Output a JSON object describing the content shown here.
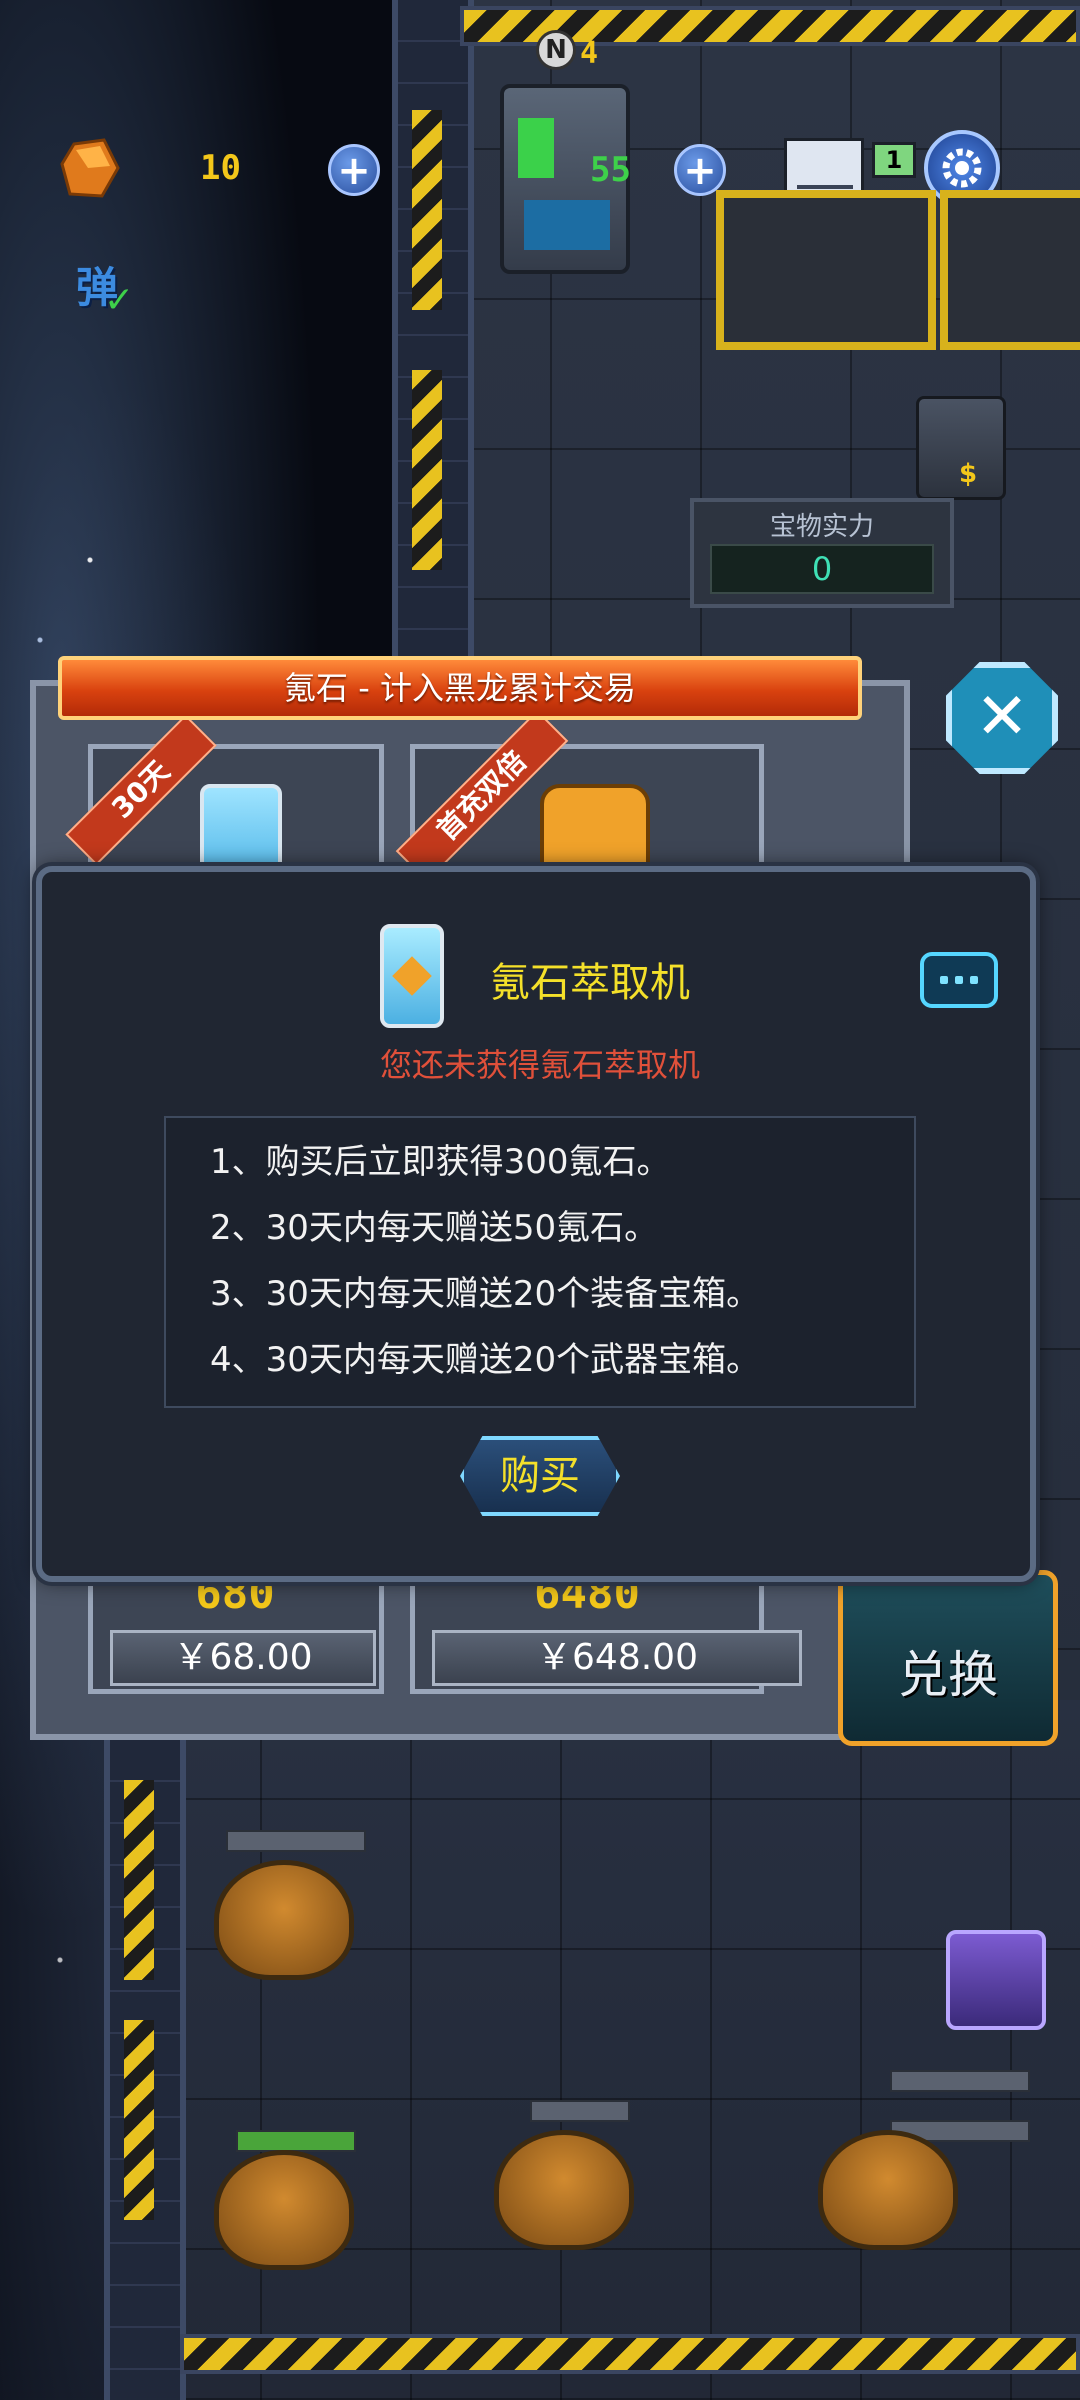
{
  "hud": {
    "crystal_count": "10",
    "energy_count": "55",
    "level_badge": "4",
    "level_icon_letter": "N",
    "flag_count": "1",
    "bullet_toggle_label": "弹",
    "treasure_power_label": "宝物实力",
    "treasure_power_value": "0"
  },
  "shop": {
    "title": "氪石 - 计入黑龙累计交易",
    "cards": [
      {
        "ribbon": "30天",
        "amount": "680",
        "price": "￥68.00"
      },
      {
        "ribbon": "首充双倍",
        "amount": "6480",
        "price": "￥648.00"
      }
    ],
    "exchange_label": "兑换"
  },
  "modal": {
    "title": "氪石萃取机",
    "subtitle": "您还未获得氪石萃取机",
    "lines": [
      "1、购买后立即获得300氪石。",
      "2、30天内每天赠送50氪石。",
      "3、30天内每天赠送20个装备宝箱。",
      "4、30天内每天赠送20个武器宝箱。"
    ],
    "buy_label": "购买"
  },
  "colors": {
    "accent_yellow": "#f4e02a",
    "warning_red": "#e0503a",
    "title_orange": "#d9420f",
    "cyan_border": "#7fd8ff"
  },
  "icons": [
    "crystal-icon",
    "plus-icon",
    "gear-icon",
    "close-icon",
    "chat-icon",
    "extractor-icon",
    "drone-icon"
  ]
}
